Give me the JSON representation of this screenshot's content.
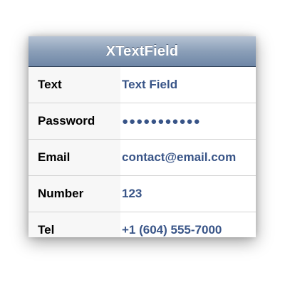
{
  "navbar": {
    "title": "XTextField"
  },
  "rows": [
    {
      "label": "Text",
      "value": "Text Field"
    },
    {
      "label": "Password",
      "value": "●●●●●●●●●●●"
    },
    {
      "label": "Email",
      "value": "contact@email.com"
    },
    {
      "label": "Number",
      "value": "123"
    },
    {
      "label": "Tel",
      "value": "+1 (604) 555-7000"
    }
  ],
  "colors": {
    "value_text": "#385487",
    "label_background": "#f7f7f7",
    "navbar_gradient_top": "#b6c3d4",
    "navbar_gradient_bottom": "#6e86a6"
  }
}
